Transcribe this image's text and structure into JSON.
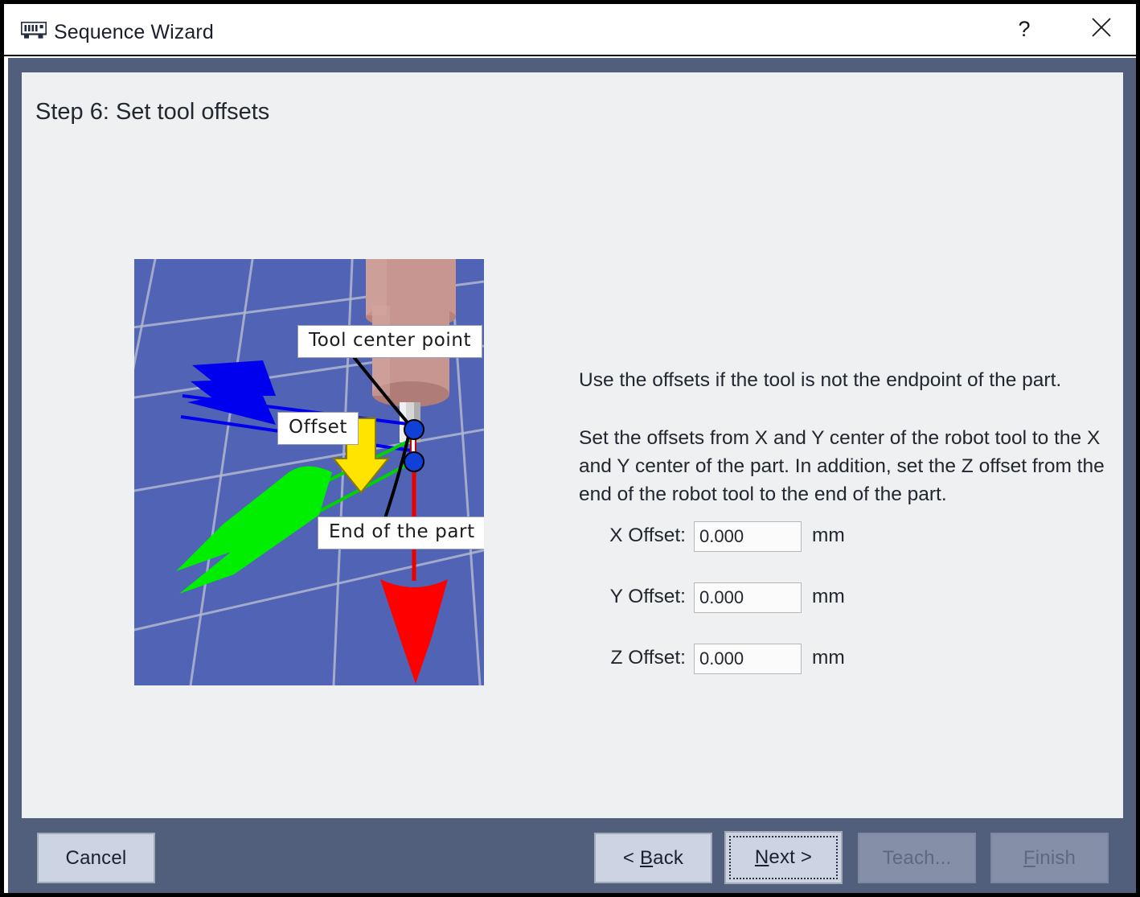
{
  "window": {
    "title": "Sequence Wizard",
    "icon": "memory-module-icon",
    "help_label": "?",
    "close_label": "✕"
  },
  "step": {
    "title": "Step 6: Set tool offsets"
  },
  "viewport": {
    "name": "robot-tool-offset-3d-preview",
    "background_color": "#5163b4",
    "grid_color": "#b9bfd6",
    "labels": [
      {
        "text": "Tool center point"
      },
      {
        "text": "Offset"
      },
      {
        "text": "End of the part"
      }
    ],
    "axis_colors": {
      "x_blue": "#0000ee",
      "y_green": "#00e800",
      "z_red": "#ee0000",
      "offset_arrow_yellow": "#ffe400",
      "tool_body": "#c89490",
      "node_marker": "#1040d8"
    }
  },
  "description": {
    "paragraph_1": "Use the offsets if the tool is not the endpoint of the part.",
    "paragraph_2": "Set the offsets from X and Y center of the robot tool to the X and Y center of the part.  In addition, set the Z offset from the end of the robot tool to the end of the part."
  },
  "fields": [
    {
      "label": "X Offset:",
      "value": "0.000",
      "unit": "mm"
    },
    {
      "label": "Y Offset:",
      "value": "0.000",
      "unit": "mm"
    },
    {
      "label": "Z Offset:",
      "value": "0.000",
      "unit": "mm"
    }
  ],
  "footer": {
    "cancel": "Cancel",
    "back": "< Back",
    "next": "Next >",
    "teach": "Teach...",
    "finish": "Finish",
    "back_parts": {
      "pre": "< ",
      "key": "B",
      "post": "ack"
    },
    "next_parts": {
      "pre": "",
      "key": "N",
      "post": "ext >"
    },
    "finish_parts": {
      "pre": "",
      "key": "F",
      "post": "inish"
    },
    "disabled": [
      "Teach...",
      "Finish"
    ],
    "focused": "Next >"
  },
  "colors": {
    "frame": "#515f7c",
    "content": "#eff0f1",
    "button": "#ccd4e4",
    "button_disabled": "#8590a8",
    "text": "#21262f"
  }
}
